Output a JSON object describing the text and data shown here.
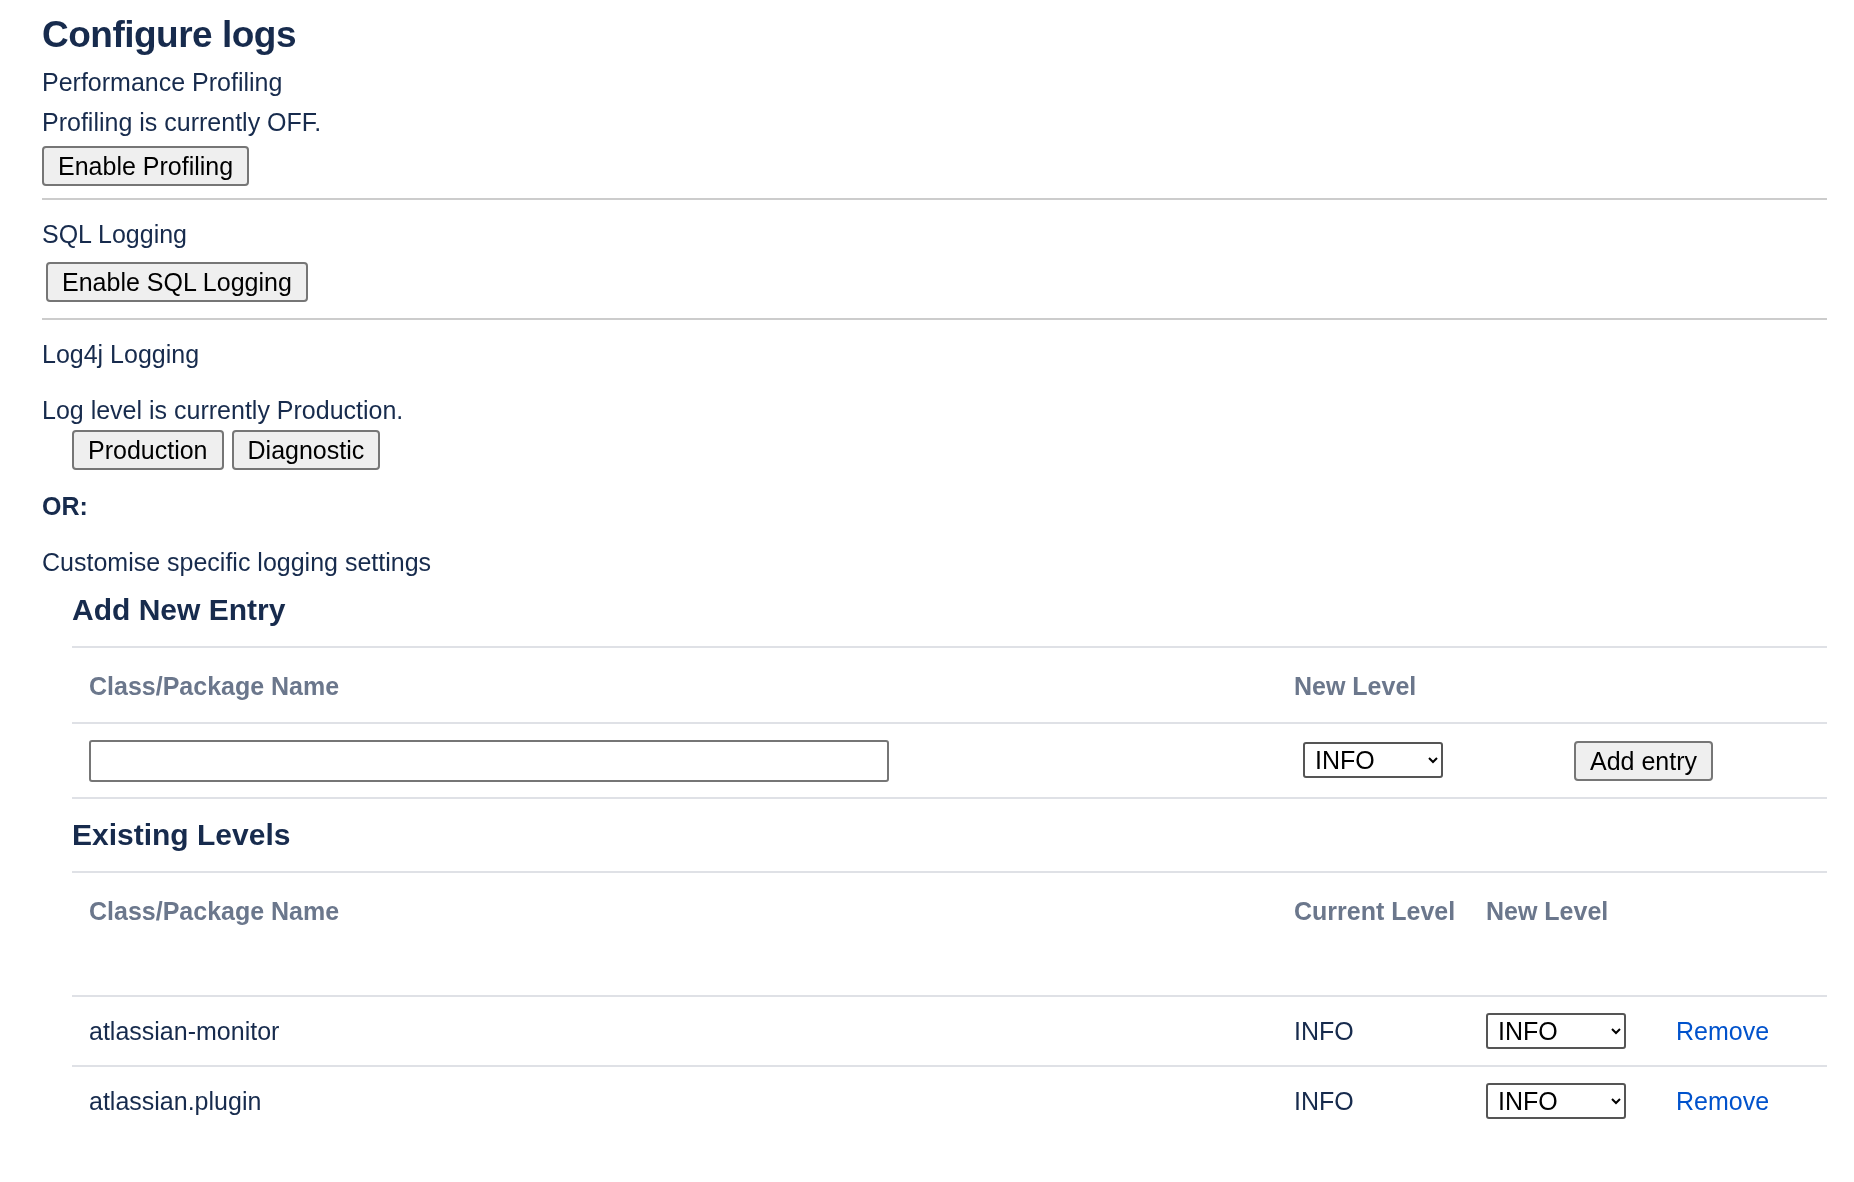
{
  "title": "Configure logs",
  "profiling": {
    "heading": "Performance Profiling",
    "status": "Profiling is currently OFF.",
    "button": "Enable Profiling"
  },
  "sql_logging": {
    "heading": "SQL Logging",
    "button": "Enable SQL Logging"
  },
  "log4j": {
    "heading": "Log4j Logging",
    "status": "Log level is currently Production.",
    "buttons": [
      "Production",
      "Diagnostic"
    ]
  },
  "or_label": "OR:",
  "customise_label": "Customise specific logging settings",
  "add_new_entry": {
    "heading": "Add New Entry",
    "columns": [
      "Class/Package Name",
      "New Level"
    ],
    "level_value": "INFO",
    "button": "Add entry"
  },
  "existing_levels": {
    "heading": "Existing Levels",
    "columns": [
      "Class/Package Name",
      "Current Level",
      "New Level"
    ],
    "rows": [
      {
        "name": "atlassian-monitor",
        "current_level": "INFO",
        "new_level": "INFO",
        "action": "Remove"
      },
      {
        "name": "atlassian.plugin",
        "current_level": "INFO",
        "new_level": "INFO",
        "action": "Remove"
      }
    ]
  }
}
